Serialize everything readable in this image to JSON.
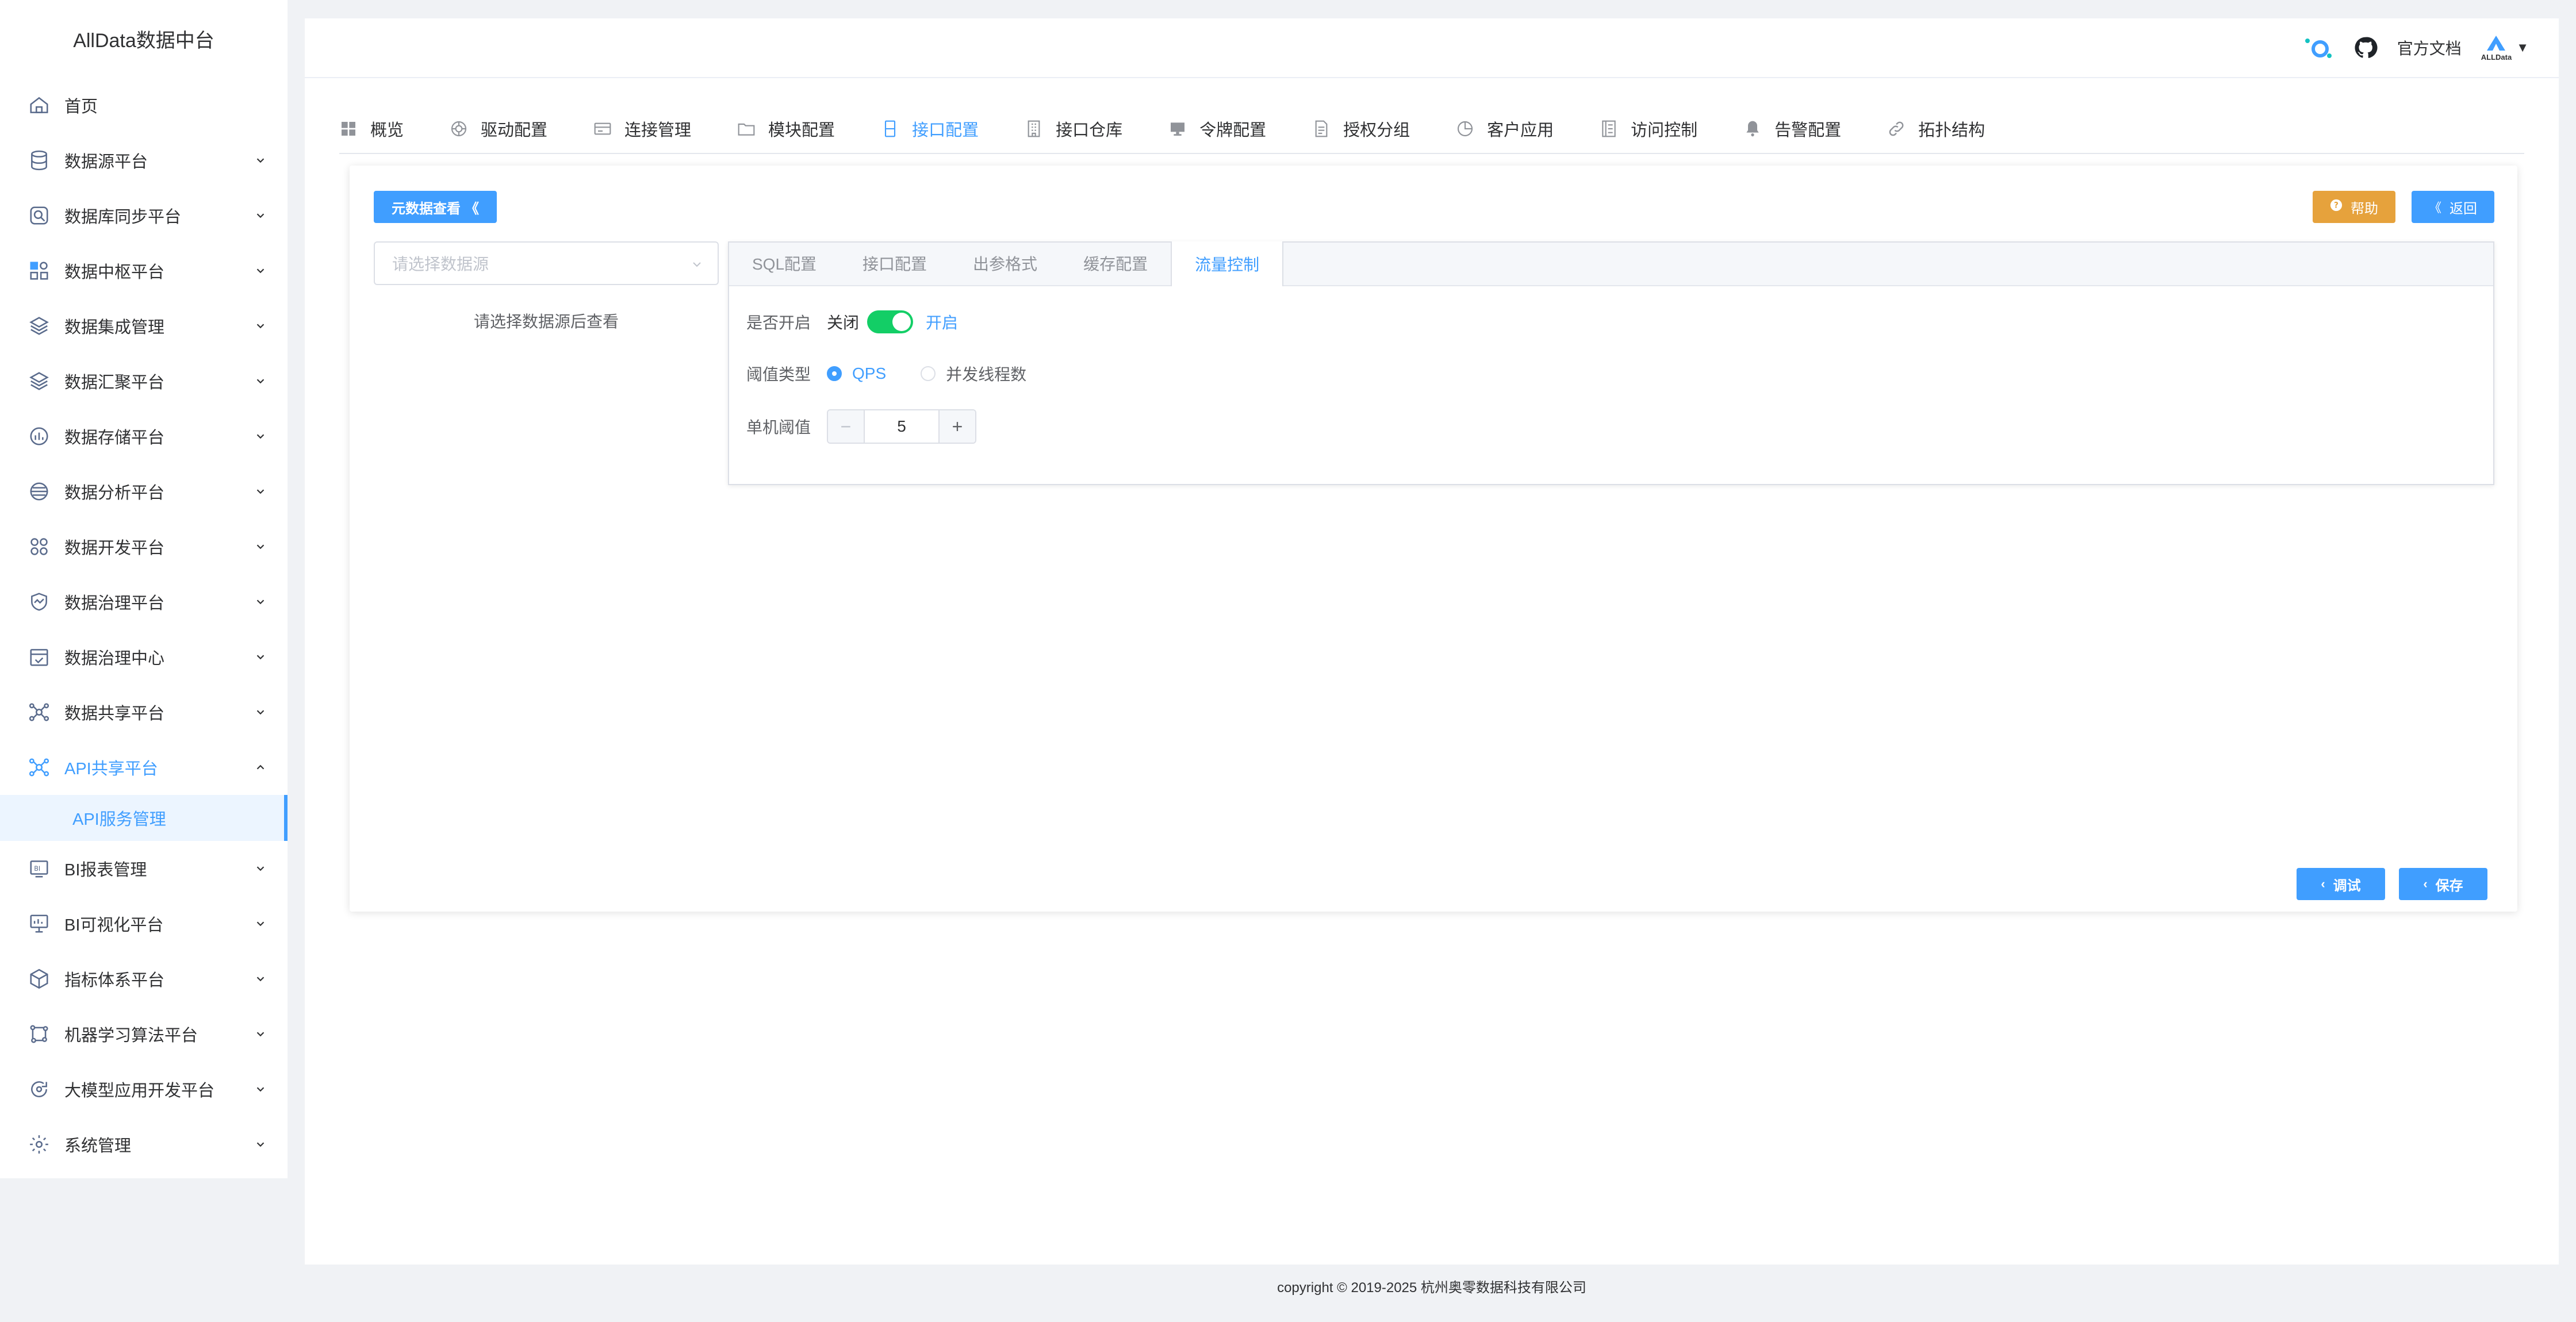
{
  "sidebar": {
    "brand": "AllData数据中台",
    "items": [
      {
        "label": "首页",
        "icon": "home-icon"
      },
      {
        "label": "数据源平台",
        "icon": "database-icon"
      },
      {
        "label": "数据库同步平台",
        "icon": "sync-icon"
      },
      {
        "label": "数据中枢平台",
        "icon": "hub-icon"
      },
      {
        "label": "数据集成管理",
        "icon": "layers-icon"
      },
      {
        "label": "数据汇聚平台",
        "icon": "layers-icon"
      },
      {
        "label": "数据存储平台",
        "icon": "storage-icon"
      },
      {
        "label": "数据分析平台",
        "icon": "analysis-icon"
      },
      {
        "label": "数据开发平台",
        "icon": "develop-icon"
      },
      {
        "label": "数据治理平台",
        "icon": "governance-icon"
      },
      {
        "label": "数据治理中心",
        "icon": "calendar-check-icon"
      },
      {
        "label": "数据共享平台",
        "icon": "share-icon"
      },
      {
        "label": "API共享平台",
        "icon": "api-share-icon"
      },
      {
        "label": "BI报表管理",
        "icon": "bi-report-icon"
      },
      {
        "label": "BI可视化平台",
        "icon": "bi-screen-icon"
      },
      {
        "label": "指标体系平台",
        "icon": "cube-icon"
      },
      {
        "label": "机器学习算法平台",
        "icon": "ml-icon"
      },
      {
        "label": "大模型应用开发平台",
        "icon": "llm-icon"
      },
      {
        "label": "系统管理",
        "icon": "settings-icon"
      }
    ],
    "sub_item": "API服务管理"
  },
  "topbar": {
    "doc_link": "官方文档",
    "logo_text": "ALLData",
    "caret": "▼"
  },
  "module_tabs": [
    {
      "label": "概览",
      "icon": "grid-icon"
    },
    {
      "label": "驱动配置",
      "icon": "driver-icon"
    },
    {
      "label": "连接管理",
      "icon": "card-icon"
    },
    {
      "label": "模块配置",
      "icon": "folder-icon"
    },
    {
      "label": "接口配置",
      "icon": "interface-icon"
    },
    {
      "label": "接口仓库",
      "icon": "building-icon"
    },
    {
      "label": "令牌配置",
      "icon": "monitor-icon"
    },
    {
      "label": "授权分组",
      "icon": "document-icon"
    },
    {
      "label": "客户应用",
      "icon": "clock-icon"
    },
    {
      "label": "访问控制",
      "icon": "list-icon"
    },
    {
      "label": "告警配置",
      "icon": "bell-icon"
    },
    {
      "label": "拓扑结构",
      "icon": "link-icon"
    }
  ],
  "card": {
    "meta_button": "元数据查看",
    "meta_button_glyph": "《",
    "help_button": "帮助",
    "back_button": "返回",
    "back_glyph": "《",
    "datasource_placeholder": "请选择数据源",
    "datasource_hint": "请选择数据源后查看",
    "tabs": [
      "SQL配置",
      "接口配置",
      "出参格式",
      "缓存配置",
      "流量控制"
    ],
    "form": {
      "enable_label": "是否开启",
      "switch_off": "关闭",
      "switch_on": "开启",
      "threshold_type_label": "阈值类型",
      "radio_qps": "QPS",
      "radio_threads": "并发线程数",
      "single_threshold_label": "单机阈值",
      "minus": "−",
      "plus": "+",
      "value": "5"
    },
    "debug_button": "调试",
    "save_button": "保存",
    "btn_glyph": "‹"
  },
  "footer": "copyright © 2019-2025 杭州奥零数据科技有限公司",
  "colors": {
    "primary": "#409eff",
    "warning": "#e6a23c",
    "success": "#13ce66"
  }
}
